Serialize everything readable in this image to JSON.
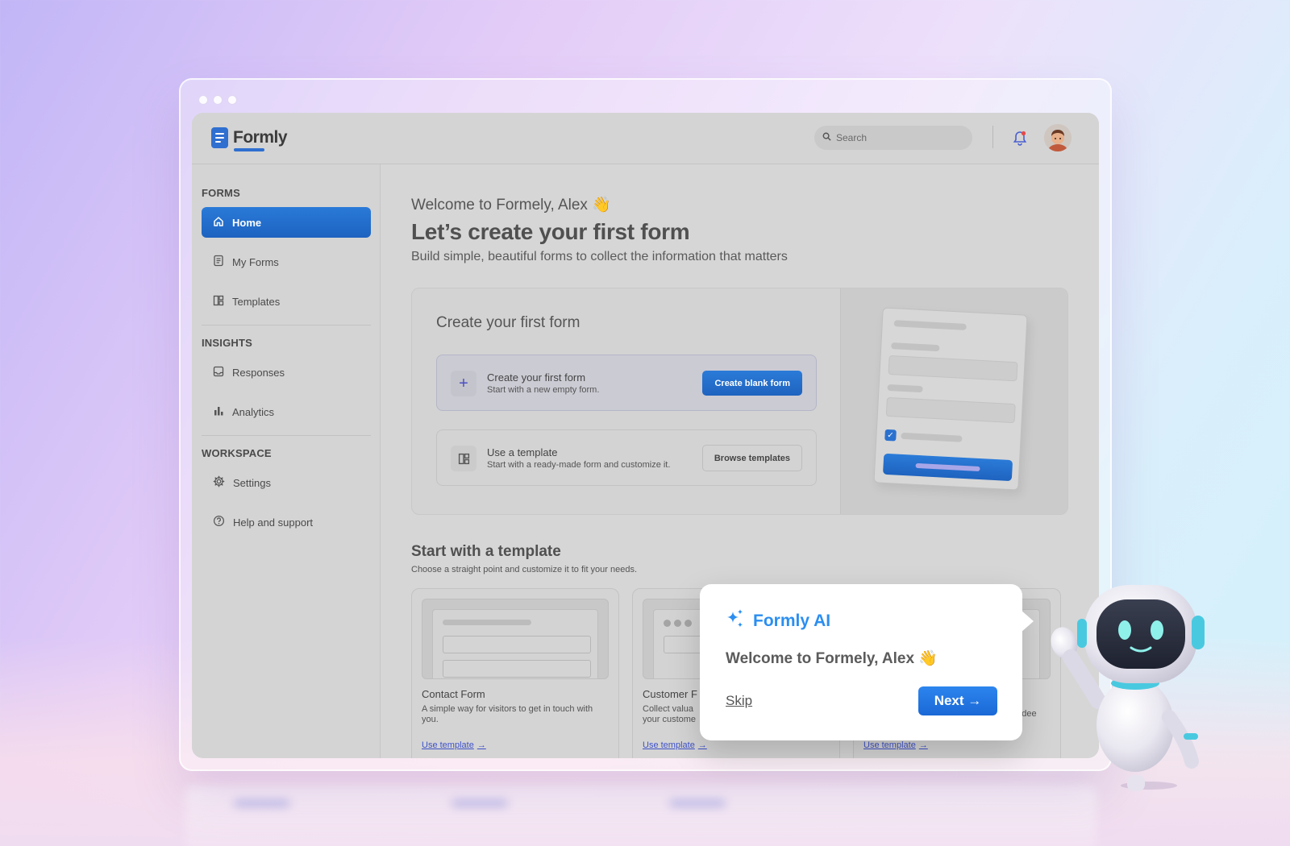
{
  "window": {
    "controls": [
      "close",
      "minimize",
      "maximize"
    ]
  },
  "app": {
    "name": "Formly"
  },
  "topbar": {
    "search_placeholder": "Search",
    "notification_icon": "bell-icon",
    "avatar_alt": "user-avatar"
  },
  "sidebar": {
    "sections": [
      {
        "label": "FORMS"
      },
      {
        "label": "INSIGHTS"
      },
      {
        "label": "WORKSPACE"
      }
    ],
    "items": [
      {
        "label": "Home",
        "icon": "home-icon",
        "active": true
      },
      {
        "label": "My Forms",
        "icon": "document-icon"
      },
      {
        "label": "Templates",
        "icon": "layout-icon"
      },
      {
        "label": "Responses",
        "icon": "inbox-icon"
      },
      {
        "label": "Analytics",
        "icon": "bar-chart-icon"
      },
      {
        "label": "Settings",
        "icon": "gear-icon"
      },
      {
        "label": "Help and support",
        "icon": "help-icon"
      }
    ]
  },
  "main": {
    "welcome": "Welcome to Formely, Alex 👋",
    "title": "Let’s create your first form",
    "subtitle": "Build simple, beautiful forms to collect the information that matters",
    "create_card": {
      "title": "Create your first form",
      "options": [
        {
          "title": "Create your first form",
          "desc": "Start with a new empty form.",
          "button": "Create blank form",
          "icon": "plus-icon"
        },
        {
          "title": "Use a template",
          "desc": "Start with a ready-made form and customize it.",
          "button": "Browse templates",
          "icon": "layout-icon"
        }
      ]
    },
    "templates": {
      "title": "Start with a template",
      "subtitle": "Choose a straight point and customize it to fit your needs.",
      "cards": [
        {
          "name": "Contact Form",
          "desc": "A simple way for visitors to get in touch with you.",
          "link": "Use template"
        },
        {
          "name": "Customer F",
          "desc": "Collect valua your custome",
          "link": "Use template"
        },
        {
          "name": "",
          "desc": "endee",
          "link": "Use template"
        }
      ]
    }
  },
  "assistant": {
    "title": "Formly AI",
    "icon": "sparkles-icon",
    "message": "Welcome to Formely, Alex 👋",
    "skip": "Skip",
    "next": "Next →",
    "colors": {
      "accent": "#2b8ef0",
      "button": "#1f72e0"
    }
  },
  "colors": {
    "brand": "#2f6fd0",
    "link": "#3f52c8",
    "active_nav": "#2270cd"
  }
}
